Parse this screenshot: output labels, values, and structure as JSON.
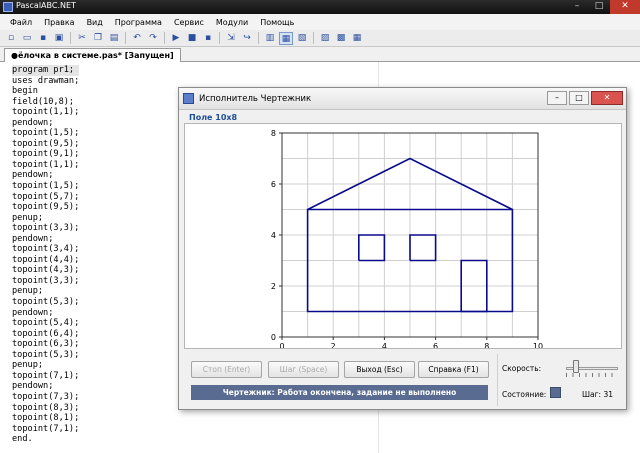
{
  "window": {
    "title": "PascalABC.NET",
    "controls": [
      "–",
      "□",
      "✕"
    ]
  },
  "menu": [
    "Файл",
    "Правка",
    "Вид",
    "Программа",
    "Сервис",
    "Модули",
    "Помощь"
  ],
  "toolbar_icons": [
    "new-file-icon",
    "open-file-icon",
    "save-icon",
    "save-all-icon",
    "|",
    "cut-icon",
    "copy-icon",
    "paste-icon",
    "|",
    "undo-icon",
    "redo-icon",
    "|",
    "run-icon",
    "stop-icon",
    "step-icon",
    "|",
    "step-into-icon",
    "step-over-icon",
    "|",
    "view-icon",
    "view-active-icon",
    "view-code-icon",
    "|",
    "form-icon",
    "form2-icon",
    "form3-icon"
  ],
  "tab": {
    "label": "●ёлочка в системе.pas* [Запущен]"
  },
  "editor": {
    "lines": [
      "program pr1;",
      "uses drawman;",
      "begin",
      "field(10,8);",
      "topoint(1,1);",
      "pendown;",
      "topoint(1,5);",
      "topoint(9,5);",
      "topoint(9,1);",
      "topoint(1,1);",
      "pendown;",
      "topoint(1,5);",
      "topoint(5,7);",
      "topoint(9,5);",
      "penup;",
      "topoint(3,3);",
      "pendown;",
      "topoint(3,4);",
      "topoint(4,4);",
      "topoint(4,3);",
      "topoint(3,3);",
      "penup;",
      "topoint(5,3);",
      "pendown;",
      "topoint(5,4);",
      "topoint(6,4);",
      "topoint(6,3);",
      "topoint(5,3);",
      "penup;",
      "topoint(7,1);",
      "pendown;",
      "topoint(7,3);",
      "topoint(8,3);",
      "topoint(8,1);",
      "topoint(7,1);",
      "end."
    ]
  },
  "drawer": {
    "title": "Исполнитель Чертежник",
    "field_label": "Поле 10x8",
    "grid": {
      "cols": 10,
      "rows": 8
    },
    "x_ticks": [
      "0",
      "2",
      "4",
      "6",
      "8",
      "10"
    ],
    "y_ticks": [
      "0",
      "2",
      "4",
      "6",
      "8"
    ],
    "path": [
      [
        1,
        1
      ],
      [
        1,
        5
      ],
      [
        9,
        5
      ],
      [
        9,
        1
      ],
      [
        1,
        1
      ],
      [
        1,
        5
      ],
      [
        5,
        7
      ],
      [
        9,
        5
      ]
    ],
    "windows": [
      [
        [
          3,
          3
        ],
        [
          3,
          4
        ],
        [
          4,
          4
        ],
        [
          4,
          3
        ],
        [
          3,
          3
        ]
      ],
      [
        [
          5,
          3
        ],
        [
          5,
          4
        ],
        [
          6,
          4
        ],
        [
          6,
          3
        ],
        [
          5,
          3
        ]
      ]
    ],
    "door": [
      [
        7,
        1
      ],
      [
        7,
        3
      ],
      [
        8,
        3
      ],
      [
        8,
        1
      ],
      [
        7,
        1
      ]
    ],
    "buttons": {
      "stop": "Стоп (Enter)",
      "step": "Шаг (Space)",
      "exit": "Выход (Esc)",
      "help": "Справка (F1)"
    },
    "status_text": "Чертежник: Работа окончена, задание не выполнено",
    "speed_label": "Скорость:",
    "speed_value": 0.2,
    "state_label": "Состояние:",
    "step_text": "Шаг: 31",
    "line_color": "#0a0a8c",
    "status_color": "#5a6b91"
  }
}
